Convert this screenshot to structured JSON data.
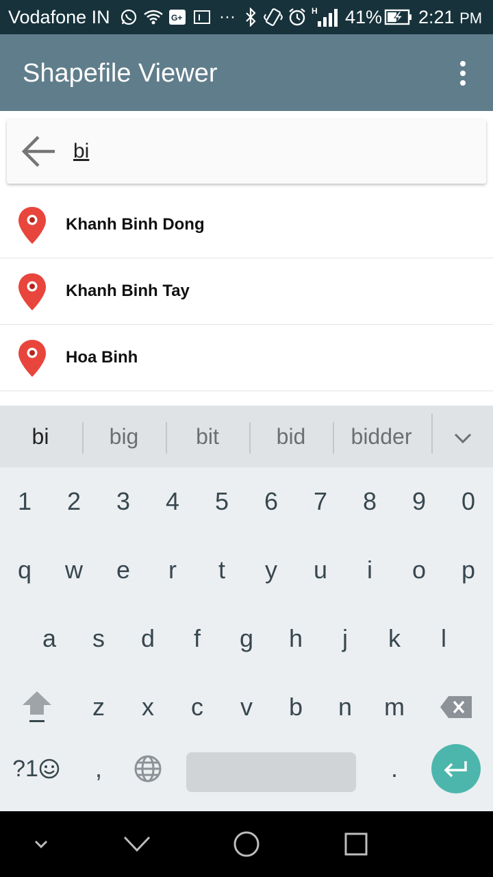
{
  "status_bar": {
    "carrier": "Vodafone IN",
    "battery_percent": "41%",
    "time": "2:21",
    "am_pm": "PM",
    "network_type": "H",
    "icons": [
      "whatsapp-icon",
      "wifi-icon",
      "google-plus-icon",
      "notification-icon",
      "more-dots-icon",
      "bluetooth-icon",
      "vibrate-icon",
      "alarm-icon",
      "signal-icon",
      "battery-charging-icon"
    ]
  },
  "app_bar": {
    "title": "Shapefile Viewer",
    "menu_icon": "overflow-menu-icon"
  },
  "search": {
    "value": "bi",
    "back_icon": "back-arrow-icon"
  },
  "results": [
    {
      "label": "Khanh Binh Dong",
      "icon": "map-pin-icon"
    },
    {
      "label": "Khanh Binh Tay",
      "icon": "map-pin-icon"
    },
    {
      "label": "Hoa Binh",
      "icon": "map-pin-icon"
    }
  ],
  "keyboard": {
    "suggestions": [
      "bi",
      "big",
      "bit",
      "bid",
      "bidder"
    ],
    "number_row": [
      "1",
      "2",
      "3",
      "4",
      "5",
      "6",
      "7",
      "8",
      "9",
      "0"
    ],
    "row1": [
      "q",
      "w",
      "e",
      "r",
      "t",
      "y",
      "u",
      "i",
      "o",
      "p"
    ],
    "row2": [
      "a",
      "s",
      "d",
      "f",
      "g",
      "h",
      "j",
      "k",
      "l"
    ],
    "row3": [
      "z",
      "x",
      "c",
      "v",
      "b",
      "n",
      "m"
    ],
    "symbols_label": "?1",
    "comma": ",",
    "period": ".",
    "colors": {
      "background": "#eceff1",
      "enter": "#4db6ac",
      "key_text": "#37474f"
    }
  },
  "nav_bar": {
    "icons": [
      "hide-keyboard-icon",
      "back-icon",
      "home-icon",
      "recents-icon"
    ]
  },
  "colors": {
    "status_bar": "#17323b",
    "app_bar": "#607d8b",
    "pin": "#e8453c"
  }
}
